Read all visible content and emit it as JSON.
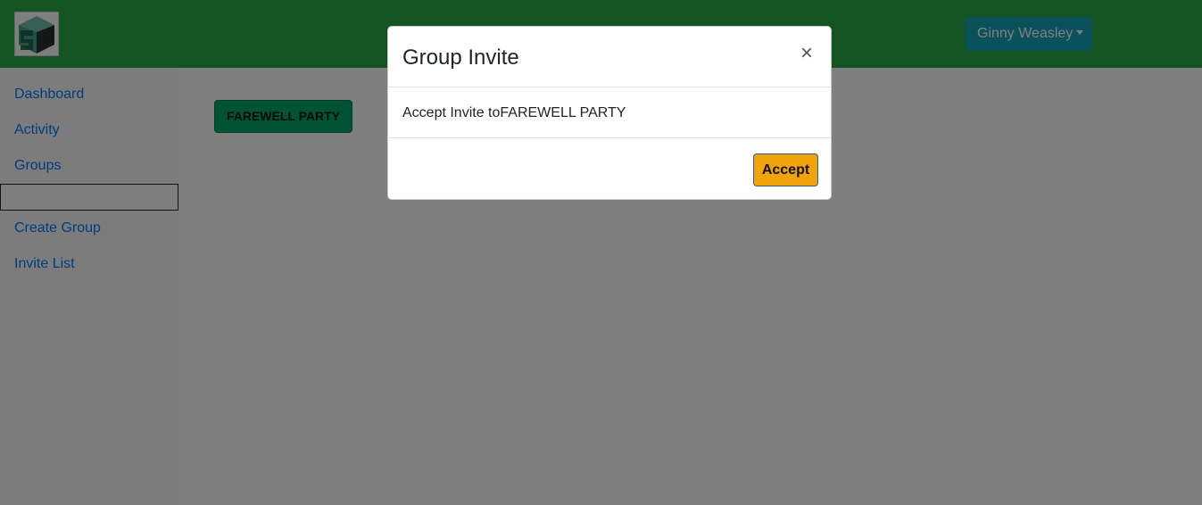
{
  "header": {
    "logo_icon": "app-logo-icon",
    "user_name": "Ginny Weasley",
    "dropdown_icon": "caret-down-icon",
    "colors": {
      "navbar": "#28a745",
      "user_button": "#17a2b8"
    }
  },
  "sidebar": {
    "items": [
      {
        "label": "Dashboard"
      },
      {
        "label": "Activity"
      },
      {
        "label": "Groups"
      },
      {
        "label": "Create Group"
      },
      {
        "label": "Invite List"
      }
    ],
    "search": {
      "value": "",
      "placeholder": ""
    }
  },
  "main": {
    "group_button_label": "FAREWELL PARTY"
  },
  "modal": {
    "title": "Group Invite",
    "close_symbol": "×",
    "body": "Accept Invite toFAREWELL PARTY",
    "accept_label": "Accept",
    "colors": {
      "accept_button": "#f0a30a"
    }
  }
}
